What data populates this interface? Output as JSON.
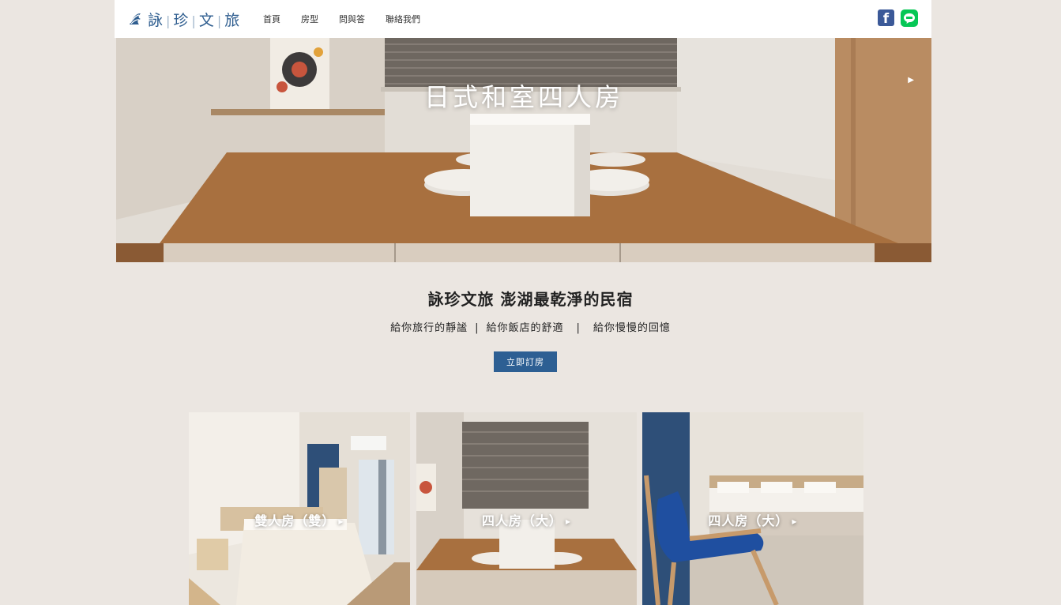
{
  "header": {
    "logo": {
      "name_chars": [
        "詠",
        "珍",
        "文",
        "旅"
      ],
      "separator": "|"
    },
    "nav": [
      {
        "label": "首頁"
      },
      {
        "label": "房型"
      },
      {
        "label": "問與答"
      },
      {
        "label": "聯絡我們"
      }
    ],
    "social": {
      "facebook_icon": "facebook-icon",
      "line_icon": "line-icon",
      "fb_glyph": "f"
    }
  },
  "hero": {
    "title": "日式和室四人房",
    "next_arrow": "▶"
  },
  "intro": {
    "title": "詠珍文旅 澎湖最乾淨的民宿",
    "taglines": [
      "給你旅行的靜謐",
      "給你飯店的舒適",
      "給你慢慢的回憶"
    ],
    "separator": "|",
    "book_button": "立即訂房"
  },
  "rooms": [
    {
      "label": "雙人房（雙）",
      "arrow": "▶"
    },
    {
      "label": "四人房（大）",
      "arrow": "▶"
    },
    {
      "label": "四人房（大）",
      "arrow": "▶"
    }
  ],
  "colors": {
    "brand": "#2e5d8f",
    "button": "#2d5f93",
    "page_background": "#ebe6e1",
    "facebook": "#3b5998",
    "line": "#06c755"
  }
}
